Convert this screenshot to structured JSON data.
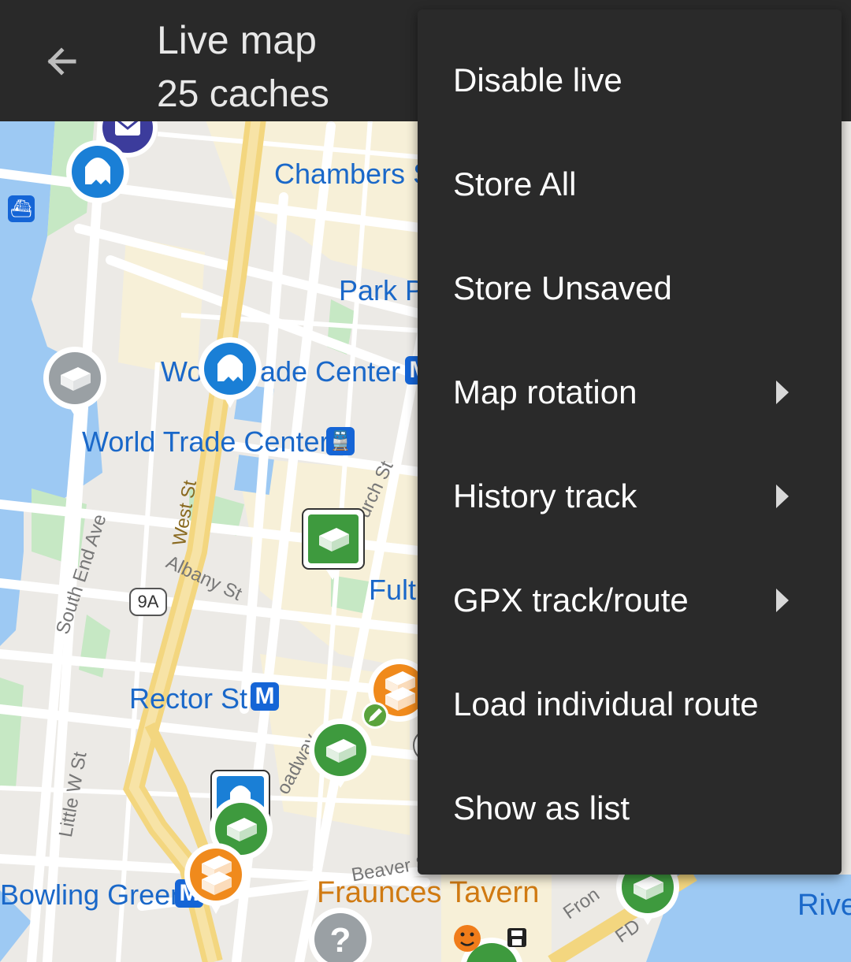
{
  "toolbar": {
    "back_icon": "arrow-left-icon",
    "title": "Live map",
    "subtitle": "25 caches"
  },
  "menu": {
    "items": [
      {
        "label": "Disable live",
        "submenu": false
      },
      {
        "label": "Store All",
        "submenu": false
      },
      {
        "label": "Store Unsaved",
        "submenu": false
      },
      {
        "label": "Map rotation",
        "submenu": true
      },
      {
        "label": "History track",
        "submenu": true
      },
      {
        "label": "GPX track/route",
        "submenu": true
      },
      {
        "label": "Load individual route",
        "submenu": false
      },
      {
        "label": "Show as list",
        "submenu": false
      }
    ]
  },
  "map": {
    "labels": {
      "chambers": "Chambers S",
      "park_place": "Park P",
      "wtc_upper_left": "Wo",
      "wtc_upper_right": "ade Center",
      "wtc_station": "World Trade Center",
      "fulton": "Fult",
      "rector": "Rector St",
      "bowling_green": "Bowling Green",
      "fraunces": "Fraunces Tavern",
      "west_st": "West St",
      "church_st": "urch St",
      "albany_st": "Albany St",
      "south_end_ave": "South End Ave",
      "little_w_st": "Little W St",
      "broadway": "oadway",
      "beaver_st": "Beaver S",
      "route_9a": "9A",
      "front": "Fron",
      "fdr": "FD",
      "right_edge_river": "Rive",
      "metro_letter": "M"
    },
    "colors": {
      "water": "#9dc9f3",
      "park": "#c6e8c4",
      "land": "#f7f0d8",
      "road": "#ffffff",
      "highway": "#f7d98b",
      "toolbar_bg": "#292929",
      "menu_bg": "#2a2a2a",
      "cache_traditional": "#3e9a3e",
      "cache_multi": "#f08a1c",
      "cache_virtual": "#1a7fd6",
      "cache_disabled": "#9aa0a4",
      "cache_mystery": "#9aa0a4",
      "cache_letterbox": "#3c3c9c"
    },
    "markers": [
      {
        "type": "letterbox",
        "icon": "envelope-icon"
      },
      {
        "type": "virtual",
        "icon": "ghost-icon"
      },
      {
        "type": "disabled",
        "icon": "box-icon"
      },
      {
        "type": "virtual",
        "icon": "ghost-icon"
      },
      {
        "type": "traditional",
        "icon": "box-icon"
      },
      {
        "type": "multi",
        "icon": "boxes-icon"
      },
      {
        "type": "traditional",
        "icon": "box-icon"
      },
      {
        "type": "virtual",
        "icon": "ghost-icon"
      },
      {
        "type": "traditional",
        "icon": "box-icon"
      },
      {
        "type": "multi",
        "icon": "boxes-icon"
      },
      {
        "type": "mystery",
        "icon": "question-icon"
      },
      {
        "type": "traditional",
        "icon": "box-icon"
      },
      {
        "type": "traditional",
        "icon": "box-icon"
      }
    ]
  }
}
